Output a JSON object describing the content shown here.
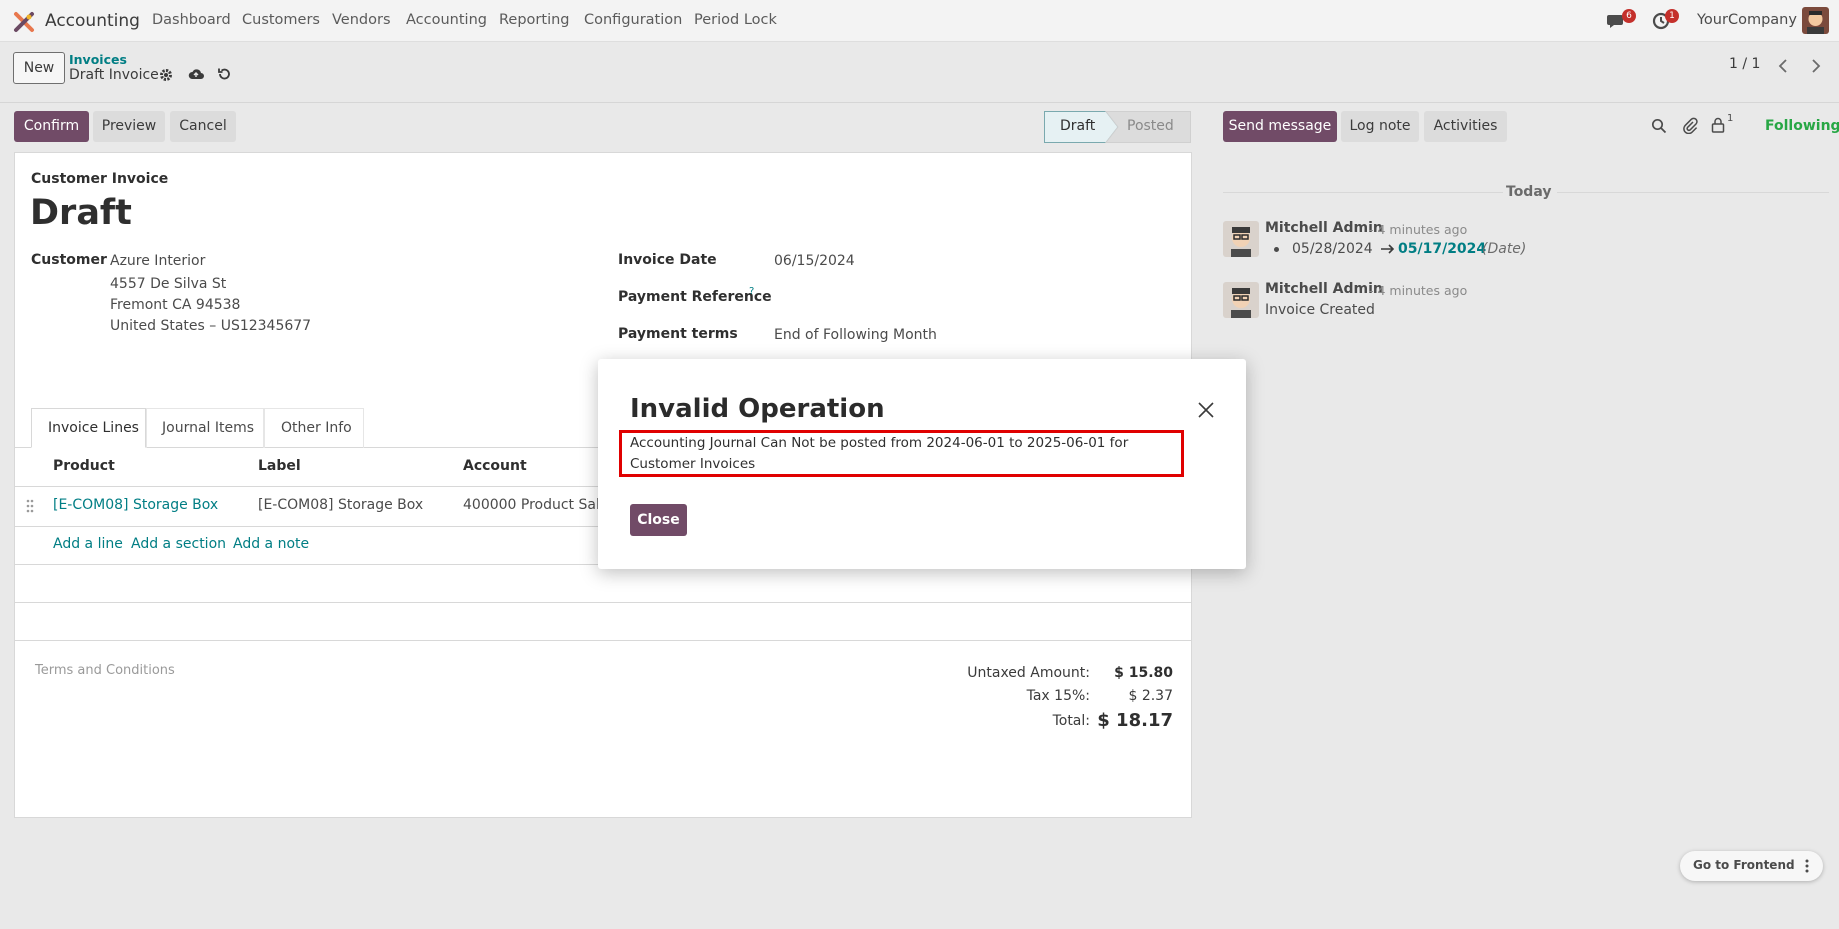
{
  "navbar": {
    "app_name": "Accounting",
    "menu": [
      "Dashboard",
      "Customers",
      "Vendors",
      "Accounting",
      "Reporting",
      "Configuration",
      "Period Lock"
    ],
    "messages_count": "6",
    "activities_count": "1",
    "company": "YourCompany"
  },
  "control": {
    "new_label": "New",
    "breadcrumb_parent": "Invoices",
    "breadcrumb_current": "Draft Invoice",
    "pager": "1 / 1"
  },
  "actions": {
    "confirm": "Confirm",
    "preview": "Preview",
    "cancel": "Cancel",
    "status_draft": "Draft",
    "status_posted": "Posted"
  },
  "form": {
    "doc_type": "Customer Invoice",
    "state_title": "Draft",
    "customer_label": "Customer",
    "customer_name": "Azure Interior",
    "address_line1": "4557 De Silva St",
    "address_line2": "Fremont CA 94538",
    "address_line3": "United States – US12345677",
    "invoice_date_label": "Invoice Date",
    "invoice_date": "06/15/2024",
    "payment_ref_label": "Payment Reference",
    "payment_ref_help": "?",
    "payment_terms_label": "Payment terms",
    "payment_terms": "End of Following Month",
    "tabs": [
      "Invoice Lines",
      "Journal Items",
      "Other Info"
    ],
    "columns": [
      "Product",
      "Label",
      "Account"
    ],
    "line": {
      "product": "[E-COM08] Storage Box",
      "label": "[E-COM08] Storage Box",
      "account": "400000 Product Sales"
    },
    "add_line": "Add a line",
    "add_section": "Add a section",
    "add_note": "Add a note",
    "terms_placeholder": "Terms and Conditions",
    "untaxed_label": "Untaxed Amount:",
    "untaxed_value": "$ 15.80",
    "tax_label": "Tax 15%:",
    "tax_value": "$ 2.37",
    "total_label": "Total:",
    "total_value": "$ 18.17"
  },
  "chatter": {
    "send_message": "Send message",
    "log_note": "Log note",
    "activities": "Activities",
    "followers_count": "1",
    "following": "Following",
    "date_separator": "Today",
    "messages": [
      {
        "author": "Mitchell Admin",
        "time": "- 4 minutes ago",
        "old_value": "05/28/2024",
        "new_value": "05/17/2024",
        "field": "(Date)"
      },
      {
        "author": "Mitchell Admin",
        "time": "- 4 minutes ago",
        "body": "Invoice Created"
      }
    ]
  },
  "dialog": {
    "title": "Invalid Operation",
    "message": "Accounting Journal Can Not be posted from 2024-06-01 to 2025-06-01 for Customer Invoices",
    "close_label": "Close"
  },
  "footer": {
    "go_frontend": "Go to Frontend"
  },
  "colors": {
    "brand": "#714b67",
    "link": "#017e84",
    "following": "#28a745",
    "highlight": "#e00000"
  }
}
